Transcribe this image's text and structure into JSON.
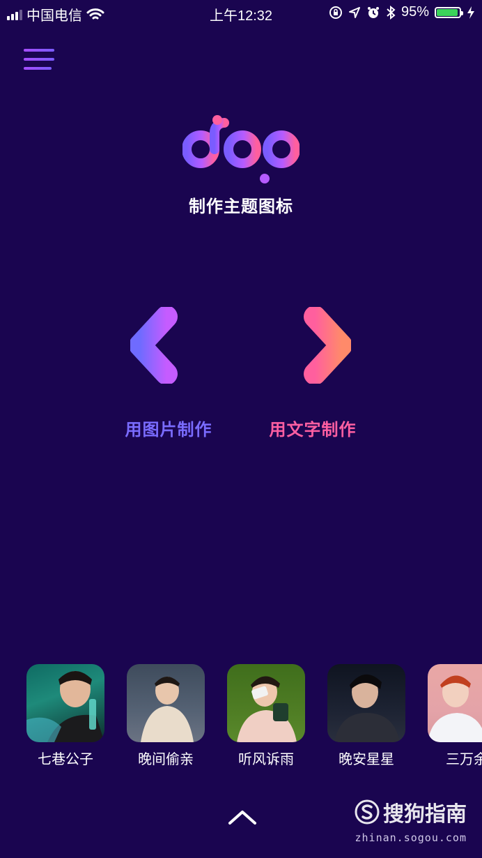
{
  "status_bar": {
    "carrier": "中国电信",
    "time": "上午12:32",
    "battery_percent": "95%",
    "battery_level": 0.95,
    "icons": [
      "signal-icon",
      "wifi-icon",
      "orientation-lock-icon",
      "location-icon",
      "alarm-icon",
      "bluetooth-icon",
      "battery-icon",
      "charging-icon"
    ]
  },
  "header": {
    "menu_icon": "hamburger-menu-icon",
    "logo_text": "dop",
    "subtitle": "制作主题图标"
  },
  "choices": [
    {
      "label": "用图片制作",
      "icon": "arrow-left-icon",
      "color": "#7a6cff"
    },
    {
      "label": "用文字制作",
      "icon": "arrow-right-icon",
      "color": "#ff5fa2"
    }
  ],
  "avatars": [
    {
      "name": "七巷公子"
    },
    {
      "name": "晚间偷亲"
    },
    {
      "name": "听风诉雨"
    },
    {
      "name": "晚安星星"
    },
    {
      "name": "三万余"
    }
  ],
  "footer": {
    "expand_icon": "chevron-up-icon"
  },
  "watermark": {
    "brand": "搜狗指南",
    "url": "zhinan.sogou.com"
  },
  "colors": {
    "background": "#1a0550",
    "accent_purple": "#7a6cff",
    "accent_pink": "#ff5fa2",
    "battery_green": "#3bd35a"
  }
}
